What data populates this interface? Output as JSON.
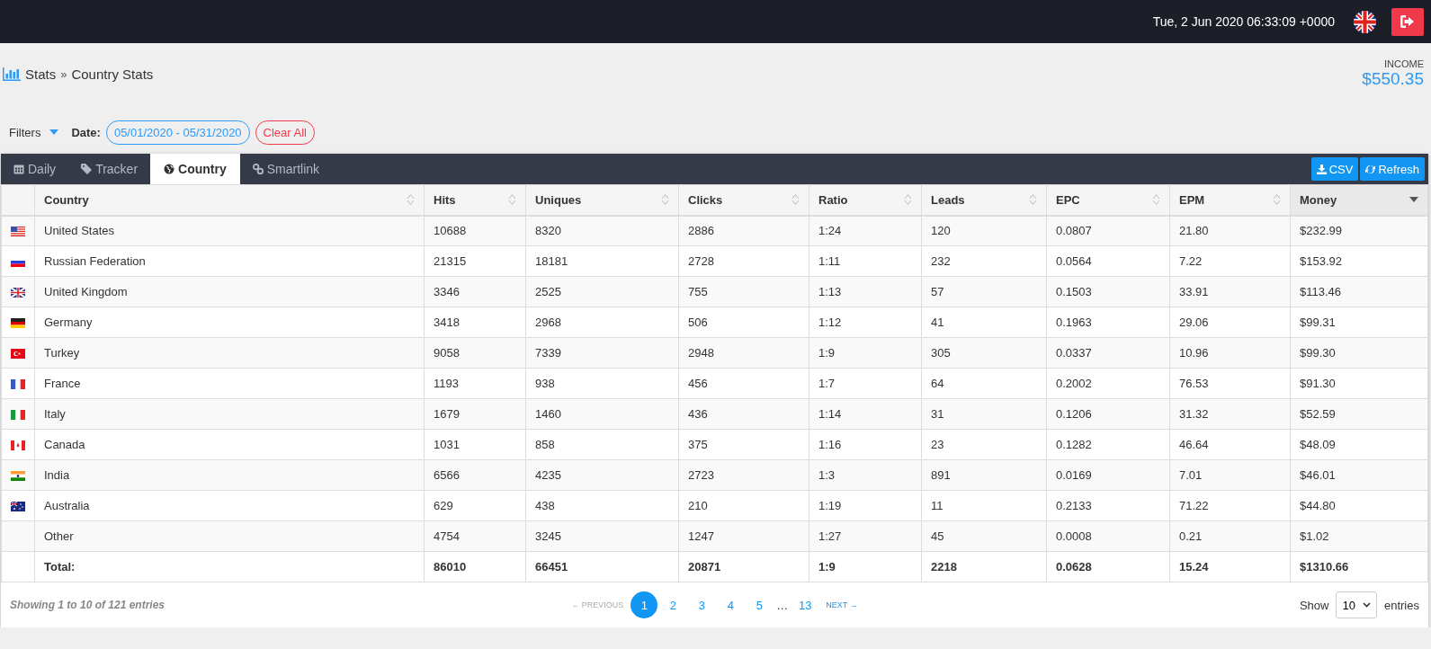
{
  "topbar": {
    "datetime": "Tue, 2 Jun 2020 06:33:09 +0000"
  },
  "breadcrumb": {
    "parent": "Stats",
    "separator": "»",
    "current": "Country Stats"
  },
  "income": {
    "label": "INCOME",
    "value": "$550.35"
  },
  "filters": {
    "toggle": "Filters",
    "date_label": "Date:",
    "date_value": "05/01/2020 - 05/31/2020",
    "clear": "Clear All"
  },
  "tabs": [
    {
      "label": "Daily",
      "kind": "calendar",
      "selected": false
    },
    {
      "label": "Tracker",
      "kind": "tag",
      "selected": false
    },
    {
      "label": "Country",
      "kind": "globe",
      "selected": true
    },
    {
      "label": "Smartlink",
      "kind": "link",
      "selected": false
    }
  ],
  "actions": [
    {
      "label": "CSV",
      "kind": "download"
    },
    {
      "label": "Refresh",
      "kind": "refresh"
    }
  ],
  "table": {
    "columns": [
      {
        "label": "Country",
        "sorted": false
      },
      {
        "label": "Hits",
        "sorted": false
      },
      {
        "label": "Uniques",
        "sorted": false
      },
      {
        "label": "Clicks",
        "sorted": false
      },
      {
        "label": "Ratio",
        "sorted": false
      },
      {
        "label": "Leads",
        "sorted": false
      },
      {
        "label": "EPC",
        "sorted": false
      },
      {
        "label": "EPM",
        "sorted": false
      },
      {
        "label": "Money",
        "sorted": true
      }
    ],
    "rows": [
      {
        "kind": "us",
        "cells": [
          "United States",
          "10688",
          "8320",
          "2886",
          "1:24",
          "120",
          "0.0807",
          "21.80",
          "$232.99"
        ]
      },
      {
        "kind": "ru",
        "cells": [
          "Russian Federation",
          "21315",
          "18181",
          "2728",
          "1:11",
          "232",
          "0.0564",
          "7.22",
          "$153.92"
        ]
      },
      {
        "kind": "gb",
        "cells": [
          "United Kingdom",
          "3346",
          "2525",
          "755",
          "1:13",
          "57",
          "0.1503",
          "33.91",
          "$113.46"
        ]
      },
      {
        "kind": "de",
        "cells": [
          "Germany",
          "3418",
          "2968",
          "506",
          "1:12",
          "41",
          "0.1963",
          "29.06",
          "$99.31"
        ]
      },
      {
        "kind": "tr",
        "cells": [
          "Turkey",
          "9058",
          "7339",
          "2948",
          "1:9",
          "305",
          "0.0337",
          "10.96",
          "$99.30"
        ]
      },
      {
        "kind": "fr",
        "cells": [
          "France",
          "1193",
          "938",
          "456",
          "1:7",
          "64",
          "0.2002",
          "76.53",
          "$91.30"
        ]
      },
      {
        "kind": "it",
        "cells": [
          "Italy",
          "1679",
          "1460",
          "436",
          "1:14",
          "31",
          "0.1206",
          "31.32",
          "$52.59"
        ]
      },
      {
        "kind": "ca",
        "cells": [
          "Canada",
          "1031",
          "858",
          "375",
          "1:16",
          "23",
          "0.1282",
          "46.64",
          "$48.09"
        ]
      },
      {
        "kind": "in",
        "cells": [
          "India",
          "6566",
          "4235",
          "2723",
          "1:3",
          "891",
          "0.0169",
          "7.01",
          "$46.01"
        ]
      },
      {
        "kind": "au",
        "cells": [
          "Australia",
          "629",
          "438",
          "210",
          "1:19",
          "11",
          "0.2133",
          "71.22",
          "$44.80"
        ]
      },
      {
        "kind": "none",
        "cells": [
          "Other",
          "4754",
          "3245",
          "1247",
          "1:27",
          "45",
          "0.0008",
          "0.21",
          "$1.02"
        ]
      }
    ],
    "total": [
      "Total:",
      "86010",
      "66451",
      "20871",
      "1:9",
      "2218",
      "0.0628",
      "15.24",
      "$1310.66"
    ]
  },
  "footer": {
    "info": "Showing 1 to 10 of 121 entries",
    "previous": {
      "label": "← PREVIOUS",
      "disabled": true
    },
    "pages": [
      {
        "label": "1",
        "kind": "page",
        "selected": true
      },
      {
        "label": "2",
        "kind": "page",
        "selected": false
      },
      {
        "label": "3",
        "kind": "page",
        "selected": false
      },
      {
        "label": "4",
        "kind": "page",
        "selected": false
      },
      {
        "label": "5",
        "kind": "page",
        "selected": false
      },
      {
        "label": "…",
        "kind": "ellipsis",
        "selected": false
      },
      {
        "label": "13",
        "kind": "page",
        "selected": false
      }
    ],
    "next": {
      "label": "NEXT →",
      "disabled": false
    },
    "show_label": "Show",
    "page_size": "10",
    "entries_label": "entries"
  }
}
